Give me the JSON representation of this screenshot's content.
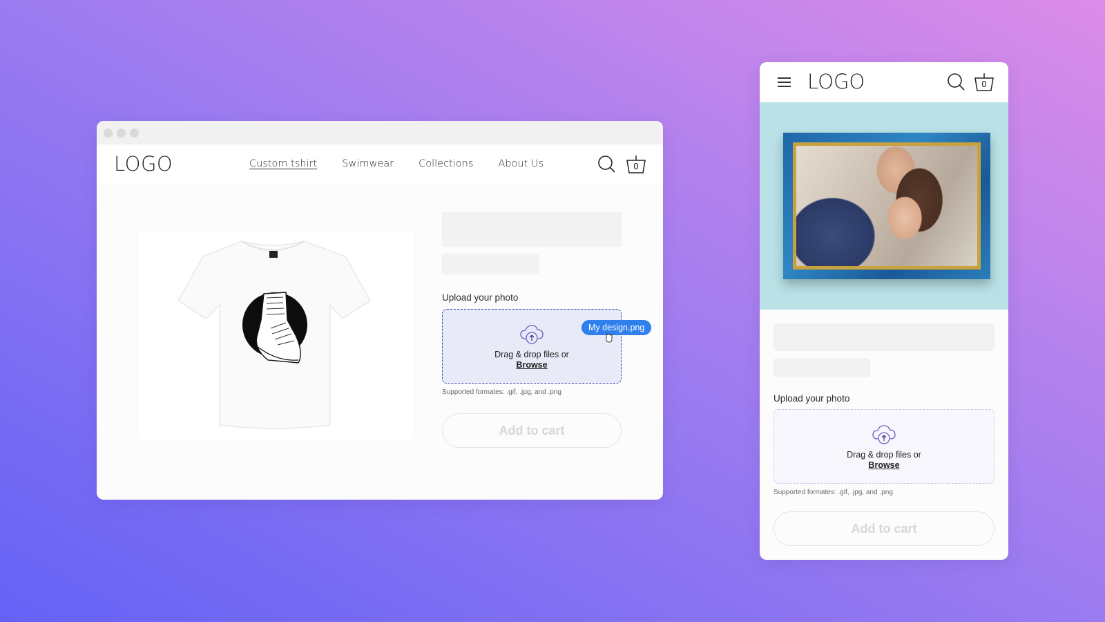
{
  "desktop": {
    "logo": "LOGO",
    "nav": [
      {
        "label": "Custom tshirt",
        "active": true
      },
      {
        "label": "Swimwear",
        "active": false
      },
      {
        "label": "Collections",
        "active": false
      },
      {
        "label": "About Us",
        "active": false
      }
    ],
    "icons": {
      "search": "search-icon",
      "cart": "basket-icon"
    },
    "cart_count": "0",
    "product_image": "white t-shirt with boot graphic",
    "upload": {
      "label": "Upload your photo",
      "drop_text": "Drag & drop files or",
      "browse_label": "Browse",
      "formats": "Supported formates: .gif, .jpg, and .png",
      "icon": "cloud-upload-icon"
    },
    "dragged_file": "My design.png",
    "add_to_cart": "Add to cart"
  },
  "mobile": {
    "logo": "LOGO",
    "icons": {
      "menu": "hamburger-icon",
      "search": "search-icon",
      "cart": "basket-icon"
    },
    "cart_count": "0",
    "hero_image": "framed photo of couple",
    "upload": {
      "label": "Upload your photo",
      "drop_text": "Drag & drop files or",
      "browse_label": "Browse",
      "formats": "Supported formates: .gif, .jpg, and .png",
      "icon": "cloud-upload-icon"
    },
    "add_to_cart": "Add to cart"
  },
  "colors": {
    "accent_blue": "#2f80ed",
    "dropzone_active_bg": "#e9eaf7",
    "dropzone_active_border": "#3b47b8",
    "icon_purple": "#6a5bc4",
    "skeleton": "#f2f2f2"
  }
}
